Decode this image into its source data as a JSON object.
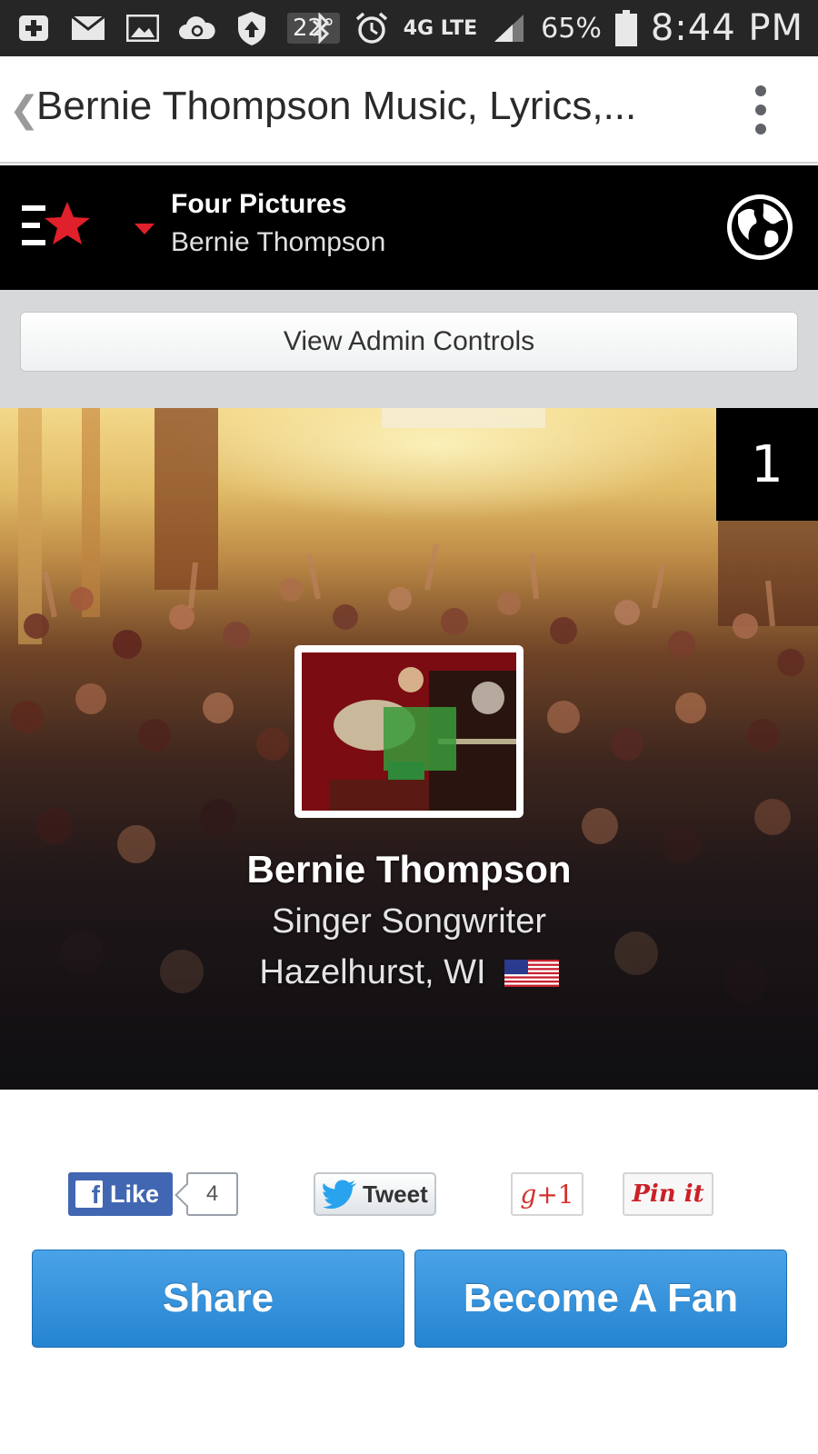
{
  "status_bar": {
    "temperature": "22°",
    "network": "4G LTE",
    "battery": "65%",
    "time": "8:44 PM",
    "icons": [
      "add-icon",
      "mail-icon",
      "image-icon",
      "cloud-icon",
      "shield-icon",
      "bluetooth-icon",
      "alarm-icon",
      "signal-icon",
      "battery-icon"
    ]
  },
  "browser": {
    "title": "Bernie Thompson Music, Lyrics,..."
  },
  "site_header": {
    "song_title": "Four Pictures",
    "artist": "Bernie Thompson"
  },
  "admin": {
    "button_label": "View Admin Controls"
  },
  "hero": {
    "rank": "1",
    "name": "Bernie Thompson",
    "role": "Singer Songwriter",
    "location": "Hazelhurst, WI",
    "flag": "us-flag-icon"
  },
  "social": {
    "like_label": "Like",
    "like_count": "4",
    "tweet_label": "Tweet",
    "gplus_label": "+1",
    "pin_label": "Pin it"
  },
  "actions": {
    "share_label": "Share",
    "fan_label": "Become A Fan"
  },
  "colors": {
    "action_blue": "#2584d0",
    "facebook_blue": "#4267b2",
    "accent_red": "#e0202a",
    "header_black": "#000000"
  }
}
